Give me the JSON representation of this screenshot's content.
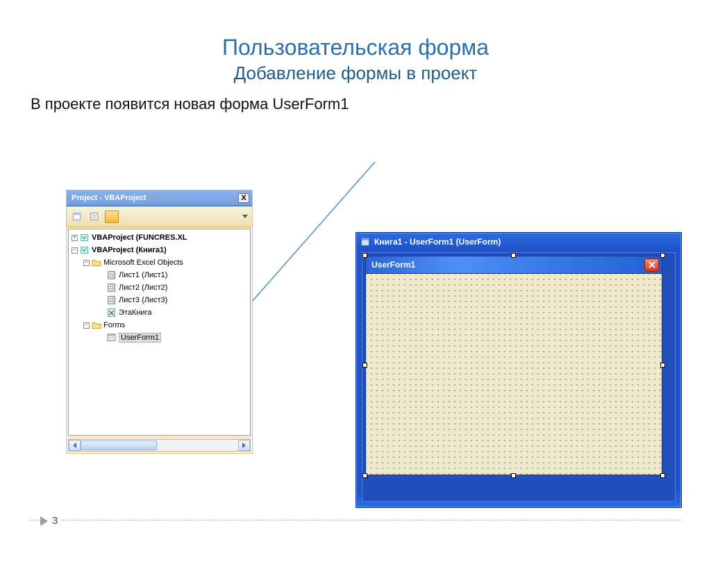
{
  "slide": {
    "title": "Пользовательская форма",
    "subtitle": "Добавление формы в проект",
    "body": "В проекте появится новая форма UserForm1",
    "pagenum": "3"
  },
  "projectPanel": {
    "header": "Project - VBAProject",
    "tree": {
      "n1": "VBAProject (FUNCRES.XL",
      "n2": "VBAProject (Книга1)",
      "n3": "Microsoft Excel Objects",
      "n4": "Лист1 (Лист1)",
      "n5": "Лист2 (Лист2)",
      "n6": "Лист3 (Лист3)",
      "n7": "ЭтаКнига",
      "n8": "Forms",
      "n9": "UserForm1"
    }
  },
  "designer": {
    "title": "Книга1 - UserForm1 (UserForm)",
    "userform": {
      "title": "UserForm1"
    }
  },
  "colors": {
    "titleColor": "#2e6fa8",
    "xpBlue": "#1f53c6",
    "formGrid": "#efe9cd"
  }
}
